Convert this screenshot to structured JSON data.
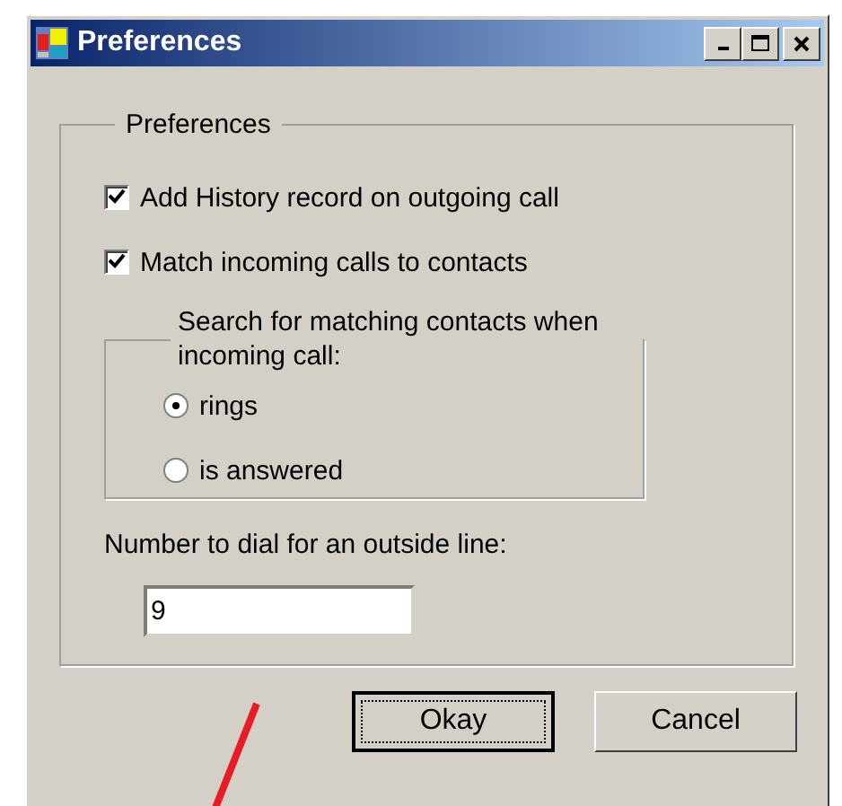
{
  "window": {
    "title": "Preferences"
  },
  "group": {
    "title": "Preferences",
    "checkboxes": [
      {
        "label": "Add History record on outgoing call",
        "checked": true
      },
      {
        "label": "Match incoming calls to contacts",
        "checked": true
      }
    ],
    "search_group": {
      "title": "Search for matching contacts when incoming call:",
      "options": [
        {
          "label": "rings",
          "selected": true
        },
        {
          "label": "is answered",
          "selected": false
        }
      ]
    },
    "outside_line": {
      "label": "Number to dial for an outside line:",
      "value": "9"
    }
  },
  "buttons": [
    {
      "label": "Okay",
      "default": true
    },
    {
      "label": "Cancel",
      "default": false
    }
  ]
}
